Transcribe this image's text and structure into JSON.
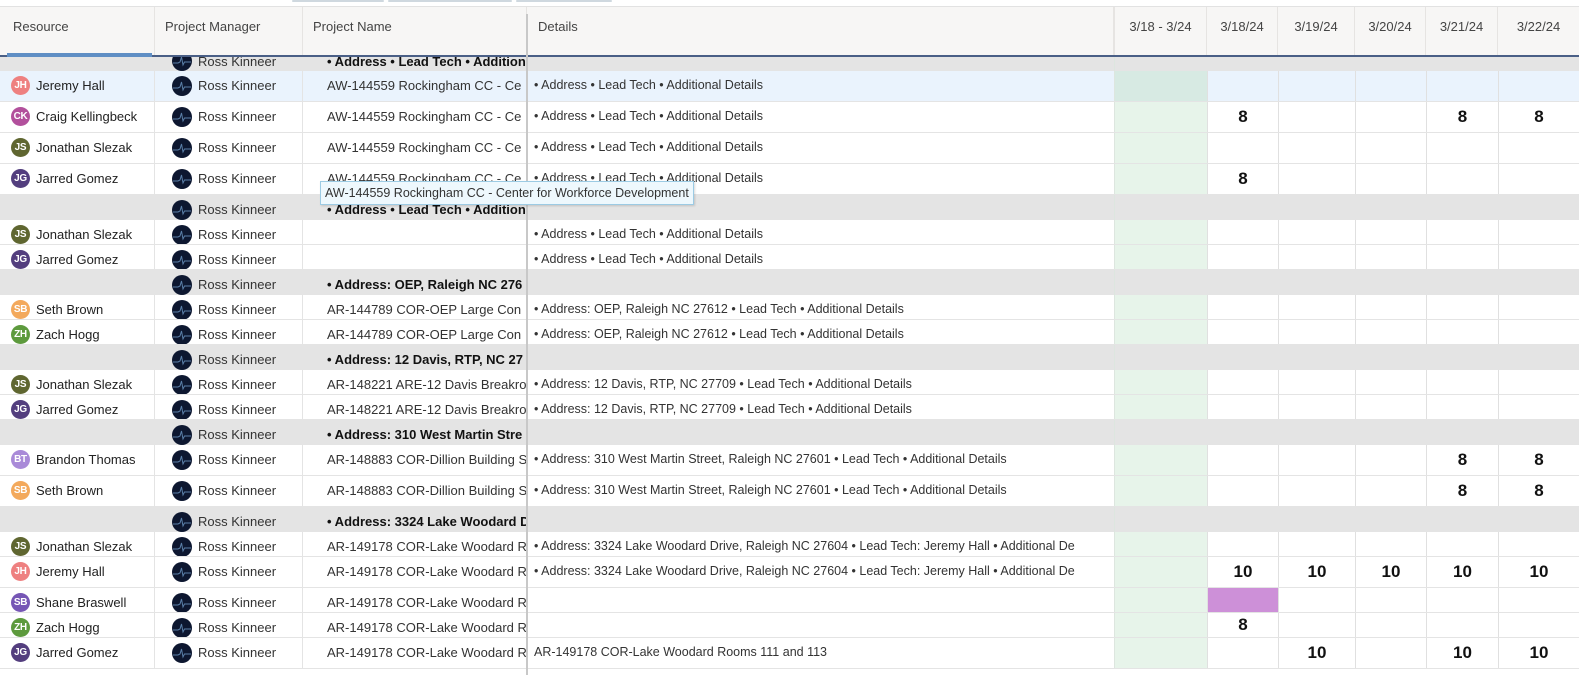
{
  "columns": {
    "resource": "Resource",
    "project_manager": "Project Manager",
    "project_name": "Project Name",
    "details": "Details",
    "week": "3/18 - 3/24",
    "days": [
      "3/18/24",
      "3/19/24",
      "3/20/24",
      "3/21/24",
      "3/22/24"
    ]
  },
  "colors": {
    "header_underline": "#4a5f86",
    "active_column_indicator": "#5f8ec4",
    "week_column": "#e7f4ea",
    "group_row": "#e4e4e4",
    "selected_row": "#eaf3fd",
    "highlight_cell": "#cd90d8"
  },
  "tooltip": "AW-144559 Rockingham CC - Center for Workforce Development",
  "rows": [
    {
      "type": "group",
      "pm": "Ross Kinneer",
      "project": "• Address • Lead Tech • Additional Details",
      "partial": true
    },
    {
      "type": "item",
      "selected": true,
      "initials": "JH",
      "color": "#ee8080",
      "resource": "Jeremy Hall",
      "pm": "Ross Kinneer",
      "project": "AW-144559 Rockingham CC - Ce",
      "details": "• Address • Lead Tech • Additional Details",
      "hours": [
        "",
        "",
        "",
        "",
        ""
      ]
    },
    {
      "type": "item",
      "initials": "CK",
      "color": "#b2509c",
      "resource": "Craig Kellingbeck",
      "pm": "Ross Kinneer",
      "project": "AW-144559 Rockingham CC - Ce",
      "details": "• Address • Lead Tech • Additional Details",
      "hours": [
        "8",
        "",
        "",
        "8",
        "8"
      ]
    },
    {
      "type": "item",
      "initials": "JS",
      "color": "#5f6630",
      "resource": "Jonathan Slezak",
      "pm": "Ross Kinneer",
      "project": "AW-144559 Rockingham CC - Ce",
      "details": "• Address • Lead Tech • Additional Details",
      "hours": [
        "",
        "",
        "",
        "",
        ""
      ]
    },
    {
      "type": "item",
      "initials": "JG",
      "color": "#533e7e",
      "resource": "Jarred Gomez",
      "pm": "Ross Kinneer",
      "project": "AW-144559 Rockingham CC - Ce",
      "details": "• Address • Lead Tech • Additional Details",
      "hours": [
        "8",
        "",
        "",
        "",
        ""
      ]
    },
    {
      "type": "group",
      "pm": "Ross Kinneer",
      "project": "• Address • Lead Tech • Additional Details"
    },
    {
      "type": "item",
      "initials": "JS",
      "color": "#5f6630",
      "resource": "Jonathan Slezak",
      "pm": "Ross Kinneer",
      "project": "",
      "details": "• Address • Lead Tech • Additional Details",
      "hours": [
        "",
        "",
        "",
        "",
        ""
      ]
    },
    {
      "type": "item",
      "initials": "JG",
      "color": "#533e7e",
      "resource": "Jarred Gomez",
      "pm": "Ross Kinneer",
      "project": "",
      "details": "• Address • Lead Tech • Additional Details",
      "hours": [
        "",
        "",
        "",
        "",
        ""
      ]
    },
    {
      "type": "group",
      "pm": "Ross Kinneer",
      "project": "• Address: OEP, Raleigh NC 276"
    },
    {
      "type": "item",
      "initials": "SB",
      "color": "#f3a95c",
      "resource": "Seth Brown",
      "pm": "Ross Kinneer",
      "project": "AR-144789 COR-OEP Large Con",
      "details": "• Address: OEP, Raleigh NC 27612 • Lead Tech • Additional Details",
      "hours": [
        "",
        "",
        "",
        "",
        ""
      ]
    },
    {
      "type": "item",
      "initials": "ZH",
      "color": "#5d9a3d",
      "resource": "Zach Hogg",
      "pm": "Ross Kinneer",
      "project": "AR-144789 COR-OEP Large Con",
      "details": "• Address: OEP, Raleigh NC 27612 • Lead Tech • Additional Details",
      "hours": [
        "",
        "",
        "",
        "",
        ""
      ]
    },
    {
      "type": "group",
      "pm": "Ross Kinneer",
      "project": "• Address: 12 Davis, RTP, NC 27"
    },
    {
      "type": "item",
      "initials": "JS",
      "color": "#5f6630",
      "resource": "Jonathan Slezak",
      "pm": "Ross Kinneer",
      "project": "AR-148221 ARE-12 Davis Breakro",
      "details": "• Address: 12 Davis, RTP, NC 27709 • Lead Tech • Additional Details",
      "hours": [
        "",
        "",
        "",
        "",
        ""
      ]
    },
    {
      "type": "item",
      "initials": "JG",
      "color": "#533e7e",
      "resource": "Jarred Gomez",
      "pm": "Ross Kinneer",
      "project": "AR-148221 ARE-12 Davis Breakro",
      "details": "• Address: 12 Davis, RTP, NC 27709 • Lead Tech • Additional Details",
      "hours": [
        "",
        "",
        "",
        "",
        ""
      ]
    },
    {
      "type": "group",
      "pm": "Ross Kinneer",
      "project": "• Address: 310 West Martin Stre"
    },
    {
      "type": "item",
      "initials": "BT",
      "color": "#a98ad8",
      "resource": "Brandon Thomas",
      "pm": "Ross Kinneer",
      "project": "AR-148883 COR-Dillion Building S",
      "details": "• Address: 310 West Martin Street, Raleigh NC 27601 • Lead Tech • Additional Details",
      "hours": [
        "",
        "",
        "",
        "8",
        "8"
      ]
    },
    {
      "type": "item",
      "initials": "SB",
      "color": "#f3a95c",
      "resource": "Seth Brown",
      "pm": "Ross Kinneer",
      "project": "AR-148883 COR-Dillion Building S",
      "details": "• Address: 310 West Martin Street, Raleigh NC 27601 • Lead Tech • Additional Details",
      "hours": [
        "",
        "",
        "",
        "8",
        "8"
      ]
    },
    {
      "type": "group",
      "pm": "Ross Kinneer",
      "project": "• Address: 3324 Lake Woodard D"
    },
    {
      "type": "item",
      "initials": "JS",
      "color": "#5f6630",
      "resource": "Jonathan Slezak",
      "pm": "Ross Kinneer",
      "project": "AR-149178 COR-Lake Woodard R",
      "details": "• Address: 3324 Lake Woodard Drive, Raleigh NC 27604 • Lead Tech: Jeremy Hall • Additional De",
      "hours": [
        "",
        "",
        "",
        "",
        ""
      ]
    },
    {
      "type": "item",
      "initials": "JH",
      "color": "#ee8080",
      "resource": "Jeremy Hall",
      "pm": "Ross Kinneer",
      "project": "AR-149178 COR-Lake Woodard R",
      "details": "• Address: 3324 Lake Woodard Drive, Raleigh NC 27604 • Lead Tech: Jeremy Hall • Additional De",
      "hours": [
        "10",
        "10",
        "10",
        "10",
        "10"
      ]
    },
    {
      "type": "item",
      "initials": "SB",
      "color": "#7656b5",
      "resource": "Shane Braswell",
      "pm": "Ross Kinneer",
      "project": "AR-149178 COR-Lake Woodard R",
      "details": "",
      "hours": [
        "",
        "",
        "",
        "",
        ""
      ],
      "highlight_day": 0
    },
    {
      "type": "item",
      "initials": "ZH",
      "color": "#5d9a3d",
      "resource": "Zach Hogg",
      "pm": "Ross Kinneer",
      "project": "AR-149178 COR-Lake Woodard R",
      "details": "",
      "hours": [
        "8",
        "",
        "",
        "",
        ""
      ]
    },
    {
      "type": "item",
      "initials": "JG",
      "color": "#533e7e",
      "resource": "Jarred Gomez",
      "pm": "Ross Kinneer",
      "project": "AR-149178 COR-Lake Woodard R",
      "details": "AR-149178 COR-Lake Woodard Rooms 111 and 113",
      "hours": [
        "",
        "10",
        "",
        "10",
        "10"
      ]
    }
  ]
}
